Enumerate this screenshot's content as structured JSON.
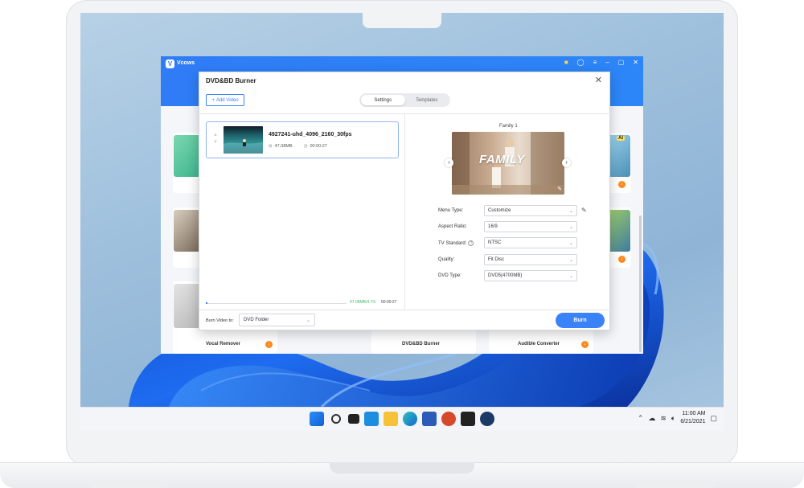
{
  "app": {
    "name": "Vcows"
  },
  "background_tools": [
    {
      "label": "Vocal Remover"
    },
    {
      "label": "DVD&BD Burner"
    },
    {
      "label": "Audible Converter"
    }
  ],
  "background_badges": {
    "ai": "AI"
  },
  "dialog": {
    "title": "DVD&BD Burner",
    "add_video": "Add Video",
    "tabs": [
      {
        "label": "Settings",
        "active": true
      },
      {
        "label": "Templates",
        "active": false
      }
    ],
    "video": {
      "name": "4927241-uhd_4096_2160_30fps",
      "size": "47.08MB",
      "duration": "00:00:27"
    },
    "progress": {
      "size_text": "47.08MB/4.7G",
      "duration_text": "00:00:27",
      "fraction": 0.01
    },
    "preview": {
      "template_name": "Family 1",
      "overlay_text": "FAMILY"
    },
    "settings": {
      "menu_type": {
        "label": "Menu Type:",
        "value": "Customize"
      },
      "aspect_ratio": {
        "label": "Aspect Ratio:",
        "value": "16/9"
      },
      "tv_standard": {
        "label": "TV Standard:",
        "value": "NTSC"
      },
      "quality": {
        "label": "Quality:",
        "value": "Fit Disc"
      },
      "dvd_type": {
        "label": "DVD Type:",
        "value": "DVD5(4700MB)"
      }
    },
    "burn_to": {
      "label": "Burn Video to:",
      "value": "DVD Folder"
    },
    "burn_button": "Burn"
  },
  "taskbar": {
    "time": "11:00 AM",
    "date": "6/21/2021"
  },
  "colors": {
    "accent": "#3a82f7",
    "header": "#2f7cf6",
    "download": "#ff8a1f"
  }
}
